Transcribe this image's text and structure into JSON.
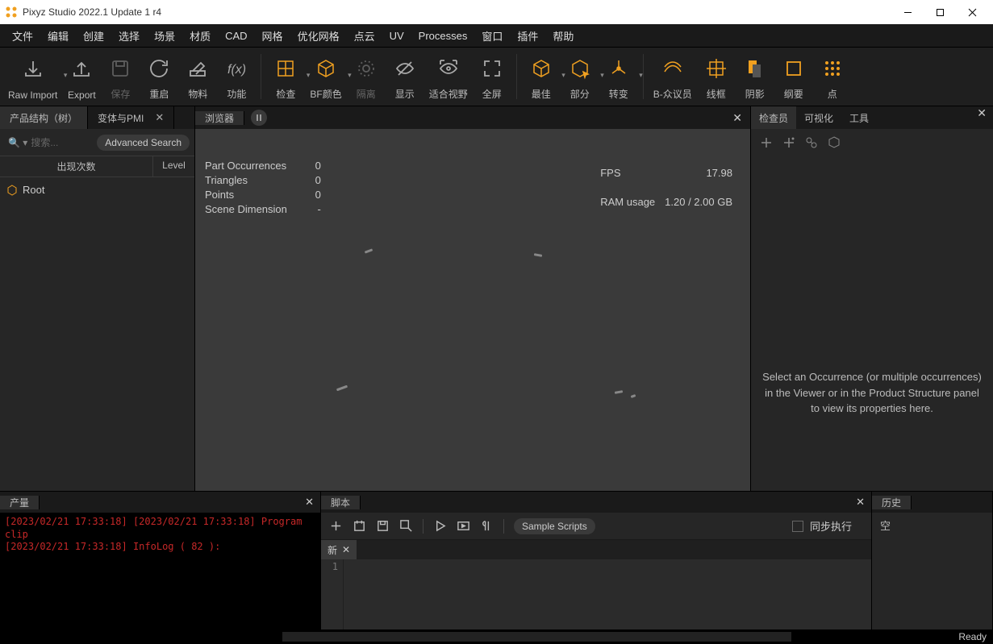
{
  "window": {
    "title": "Pixyz Studio 2022.1 Update 1 r4"
  },
  "menu": [
    "文件",
    "编辑",
    "创建",
    "选择",
    "场景",
    "材质",
    "CAD",
    "网格",
    "优化网格",
    "点云",
    "UV",
    "Processes",
    "窗口",
    "插件",
    "帮助"
  ],
  "toolbar": [
    {
      "label": "Raw Import",
      "drop": true,
      "accent": false
    },
    {
      "label": "Export",
      "drop": false,
      "accent": false
    },
    {
      "label": "保存",
      "dim": true
    },
    {
      "label": "重启"
    },
    {
      "label": "物料"
    },
    {
      "label": "功能"
    },
    {
      "label": "检查",
      "drop": true,
      "accent": true
    },
    {
      "label": "BF颜色",
      "drop": true,
      "accent": true
    },
    {
      "label": "隔离",
      "dim": true
    },
    {
      "label": "显示"
    },
    {
      "label": "适合视野"
    },
    {
      "label": "全屏"
    },
    {
      "label": "最佳",
      "drop": true,
      "accent": true
    },
    {
      "label": "部分",
      "drop": true,
      "accent": true
    },
    {
      "label": "转变",
      "drop": true,
      "accent": true
    },
    {
      "label": "B-众议员",
      "accent": true
    },
    {
      "label": "线框",
      "accent": true
    },
    {
      "label": "阴影",
      "accent": true
    },
    {
      "label": "纲要",
      "accent": true
    },
    {
      "label": "点",
      "accent": true
    }
  ],
  "leftPanel": {
    "tabs": [
      "产品结构（树）",
      "变体与PMI"
    ],
    "searchPlaceholder": "搜索...",
    "advanced": "Advanced Search",
    "col1": "出现次数",
    "col2": "Level",
    "root": "Root"
  },
  "viewer": {
    "tab": "浏览器",
    "stats": {
      "PartOccurrences": "0",
      "Triangles": "0",
      "Points": "0",
      "SceneDimension": "-",
      "FPS": "17.98",
      "RAMusage": "1.20 / 2.00 GB"
    },
    "statsLabels": {
      "po": "Part Occurrences",
      "tri": "Triangles",
      "pts": "Points",
      "sd": "Scene Dimension",
      "fps": "FPS",
      "ram": "RAM usage"
    }
  },
  "rightPanel": {
    "tabs": [
      "检查员",
      "可视化",
      "工具"
    ],
    "hint": "Select an Occurrence (or multiple occurrences) in the Viewer or in the Product Structure panel to view its properties here."
  },
  "output": {
    "tab": "产量",
    "log": "[2023/02/21 17:33:18] [2023/02/21 17:33:18] Program clip\n[2023/02/21 17:33:18] InfoLog ( 82 ):"
  },
  "script": {
    "tab": "脚本",
    "sample": "Sample Scripts",
    "sync": "同步执行",
    "fileTab": "新",
    "line1": "1"
  },
  "history": {
    "tab": "历史",
    "item": "空"
  },
  "status": {
    "ready": "Ready"
  }
}
